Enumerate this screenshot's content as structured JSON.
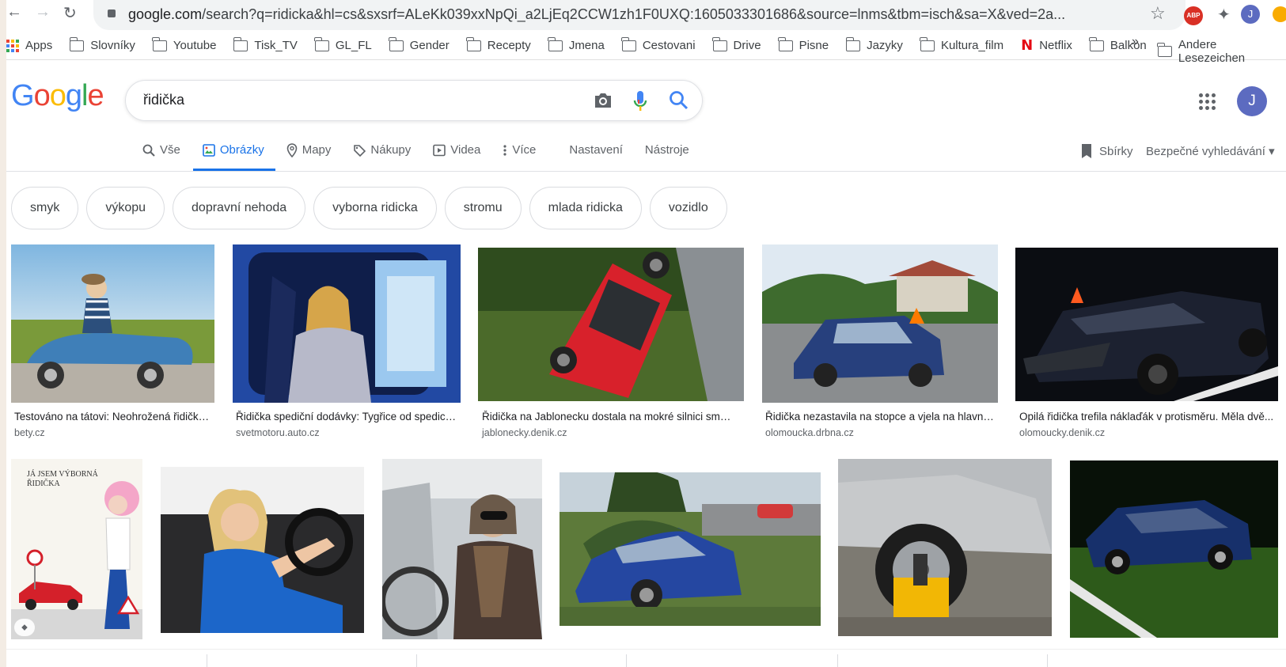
{
  "browser": {
    "url_host": "google.com",
    "url_rest": "/search?q=ridicka&hl=cs&sxsrf=ALeKk039xxNpQi_a2LjEq2CCW1zh1F0UXQ:1605033301686&source=lnms&tbm=isch&sa=X&ved=2a...",
    "abp_label": "ABP",
    "profile_initial": "J"
  },
  "bookmarks": {
    "apps_label": "Apps",
    "items": [
      "Slovníky",
      "Youtube",
      "Tisk_TV",
      "GL_FL",
      "Gender",
      "Recepty",
      "Jmena",
      "Cestovani",
      "Drive",
      "Pisne",
      "Jazyky",
      "Kultura_film"
    ],
    "netflix_label": "Netflix",
    "netflix_glyph": "N",
    "after_netflix": "Balkon",
    "more": "»",
    "other": "Andere Lesezeichen"
  },
  "logo": [
    "G",
    "o",
    "o",
    "g",
    "l",
    "e"
  ],
  "logo_colors": [
    "#4285f4",
    "#ea4335",
    "#fbbc05",
    "#4285f4",
    "#34a853",
    "#ea4335"
  ],
  "search": {
    "query": "řidička"
  },
  "account": {
    "initial": "J"
  },
  "tabs": {
    "all": "Vše",
    "images": "Obrázky",
    "maps": "Mapy",
    "shopping": "Nákupy",
    "videos": "Videa",
    "more": "Více",
    "settings": "Nastavení",
    "tools": "Nástroje"
  },
  "collections": "Sbírky",
  "safe_search": "Bezpečné vyhledávání ▾",
  "chips": [
    "smyk",
    "výkopu",
    "dopravní nehoda",
    "vyborna ridicka",
    "stromu",
    "mlada ridicka",
    "vozidlo"
  ],
  "results_row1": [
    {
      "caption": "Testováno na tátovi: Neohrožená řidička...",
      "source": "bety.cz"
    },
    {
      "caption": "Řidička spediční dodávky: Tygřice od spedice...",
      "source": "svetmotoru.auto.cz"
    },
    {
      "caption": "Řidička na Jablonecku dostala na mokré silnici smyk...",
      "source": "jablonecky.denik.cz"
    },
    {
      "caption": "Řidička nezastavila na stopce a vjela na hlavní...",
      "source": "olomoucka.drbna.cz"
    },
    {
      "caption": "Opilá řidička trefila náklaďák v protisměru. Měla dvě...",
      "source": "olomoucky.denik.cz"
    }
  ],
  "row2_image_text": {
    "cartoon_line1": "JÁ JSEM VÝBORNÁ",
    "cartoon_line2": "ŘIDIČKA"
  },
  "colors": {
    "accent": "#1a73e8",
    "text_secondary": "#5f6368"
  }
}
